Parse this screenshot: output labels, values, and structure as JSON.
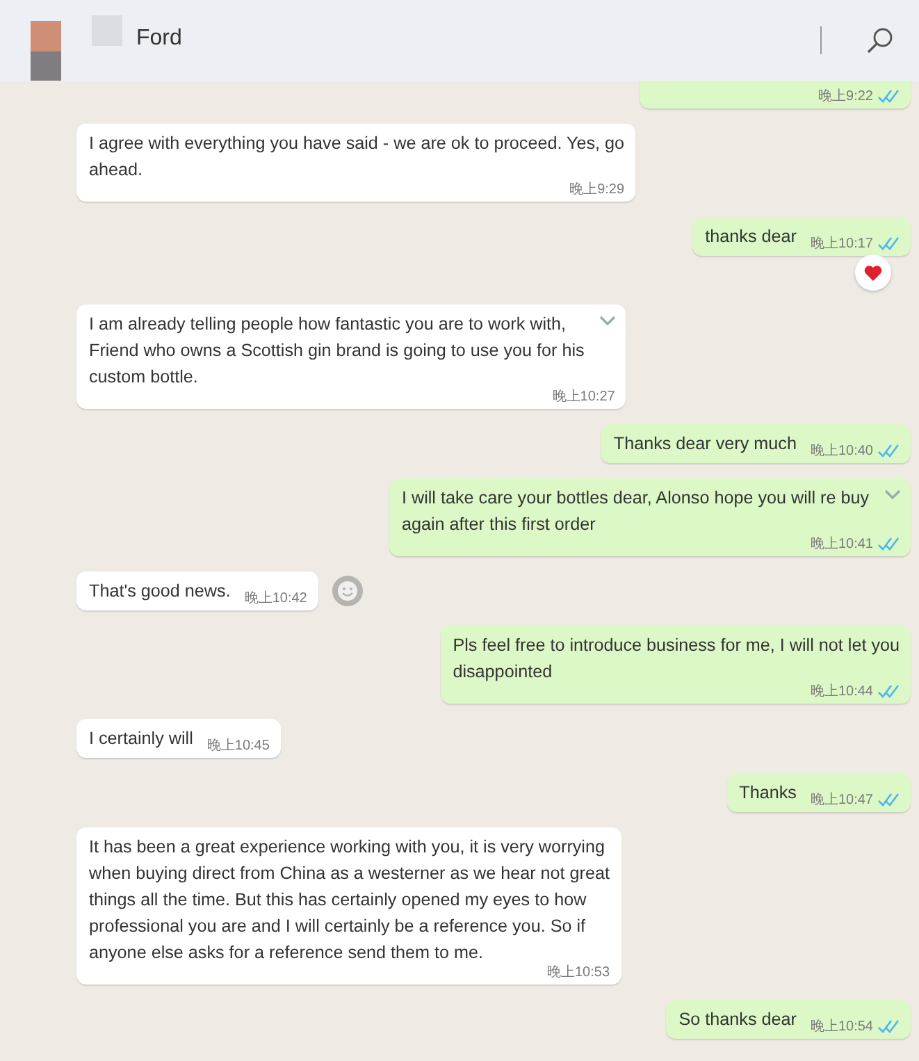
{
  "header": {
    "title": "Ford"
  },
  "messages": [
    {
      "outgoing": true,
      "time": "晚上9:22",
      "read": true
    },
    {
      "outgoing": false,
      "lines": [
        "I agree with everything you have said - we are ok to proceed. Yes, go",
        "ahead."
      ],
      "time": "晚上9:29"
    },
    {
      "outgoing": true,
      "lines": [
        "thanks dear"
      ],
      "time": "晚上10:17",
      "read": true,
      "hearted": true
    },
    {
      "outgoing": false,
      "lines": [
        "I am already telling people how fantastic you are to work with,",
        "Friend who owns a Scottish gin brand is going to use you for his",
        "custom bottle."
      ],
      "time": "晚上10:27",
      "chevron": true
    },
    {
      "outgoing": true,
      "lines": [
        "Thanks dear very much"
      ],
      "time": "晚上10:40",
      "read": true
    },
    {
      "outgoing": true,
      "lines": [
        "I will take care your bottles dear,  Alonso hope you will re buy",
        "again after this first order"
      ],
      "time": "晚上10:41",
      "read": true,
      "chevron": true
    },
    {
      "outgoing": false,
      "lines": [
        "That's good news."
      ],
      "time": "晚上10:42",
      "emoji_button": true
    },
    {
      "outgoing": true,
      "lines": [
        "Pls feel free to introduce business for me, I will not let you",
        "disappointed"
      ],
      "time": "晚上10:44",
      "read": true
    },
    {
      "outgoing": false,
      "lines": [
        "I certainly will"
      ],
      "time": "晚上10:45"
    },
    {
      "outgoing": true,
      "lines": [
        "Thanks"
      ],
      "time": "晚上10:47",
      "read": true
    },
    {
      "outgoing": false,
      "lines": [
        "It has been a great experience working with you, it is very worrying",
        "when buying direct from China as a westerner as we hear not great",
        "things all the time. But this has certainly opened my eyes to how",
        "professional you are and I will certainly be a reference you. So if",
        "anyone else asks for a reference send them to me."
      ],
      "time": "晚上10:53"
    },
    {
      "outgoing": true,
      "lines": [
        "So thanks dear"
      ],
      "time": "晚上10:54",
      "read": true
    }
  ]
}
